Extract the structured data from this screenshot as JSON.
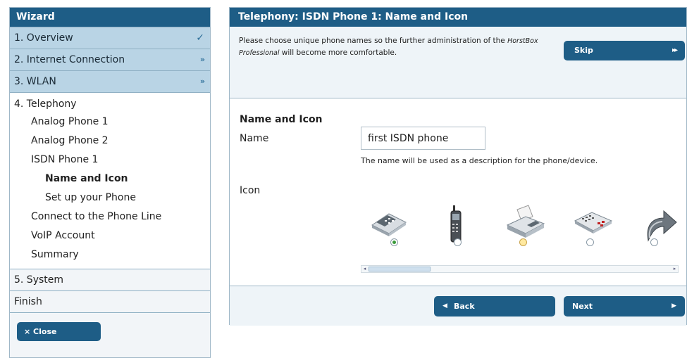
{
  "sidebar": {
    "title": "Wizard",
    "steps": [
      {
        "label": "1. Overview",
        "mark": "✓"
      },
      {
        "label": "2. Internet Connection",
        "mark": "»"
      },
      {
        "label": "3. WLAN",
        "mark": "»"
      }
    ],
    "telephony": {
      "label": "4. Telephony",
      "items": [
        "Analog Phone 1",
        "Analog Phone 2",
        "ISDN Phone 1"
      ],
      "subitems": [
        "Name and Icon",
        "Set up your Phone"
      ],
      "more": [
        "Connect to the Phone Line",
        "VoIP Account",
        "Summary"
      ]
    },
    "system": "5. System",
    "finish": "Finish",
    "close": "× Close"
  },
  "panel": {
    "title": "Telephony: ISDN Phone 1: Name and Icon",
    "intro_pre": "Please choose unique phone names so the further administration of the ",
    "intro_brand": "HorstBox Professional",
    "intro_post": " will become more comfortable.",
    "skip": "Skip",
    "section_title": "Name and Icon",
    "name_label": "Name",
    "name_value": "first ISDN phone",
    "name_hint": "The name will be used as a description for the phone/device.",
    "icon_label": "Icon",
    "icons": [
      "desk-phone-icon",
      "mobile-phone-icon",
      "fax-icon",
      "keypad-phone-icon",
      "forward-arrow-icon"
    ],
    "selected_icon": 0,
    "back": "Back",
    "next": "Next"
  },
  "colors": {
    "accent": "#1e5d86",
    "step_bg": "#b9d4e5",
    "panel_bg": "#eef4f8"
  }
}
